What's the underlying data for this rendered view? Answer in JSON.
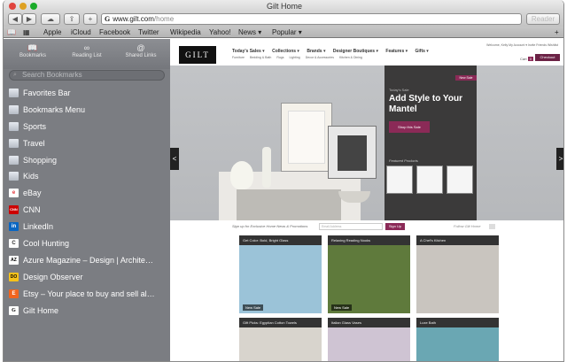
{
  "window": {
    "title": "Gilt Home"
  },
  "toolbar": {
    "back": "◀",
    "forward": "▶",
    "new_tab": "+",
    "url_host": "www.gilt.com",
    "url_path": "/home",
    "url_logo": "G",
    "reader": "Reader"
  },
  "bookmarks_bar": {
    "items": [
      "Apple",
      "iCloud",
      "Facebook",
      "Twitter",
      "Wikipedia",
      "Yahoo!",
      "News ▾",
      "Popular ▾"
    ]
  },
  "sidebar": {
    "tabs": [
      {
        "label": "Bookmarks",
        "icon": "book-icon"
      },
      {
        "label": "Reading List",
        "icon": "glasses-icon"
      },
      {
        "label": "Shared Links",
        "icon": "at-icon"
      }
    ],
    "search_placeholder": "Search Bookmarks",
    "items": [
      {
        "label": "Favorites Bar",
        "icon": "folder-icon"
      },
      {
        "label": "Bookmarks Menu",
        "icon": "folder-icon"
      },
      {
        "label": "Sports",
        "icon": "folder-icon"
      },
      {
        "label": "Travel",
        "icon": "folder-icon"
      },
      {
        "label": "Shopping",
        "icon": "folder-icon"
      },
      {
        "label": "Kids",
        "icon": "folder-icon"
      },
      {
        "label": "eBay",
        "icon": "ebay-favicon"
      },
      {
        "label": "CNN",
        "icon": "cnn-favicon"
      },
      {
        "label": "LinkedIn",
        "icon": "linkedin-favicon"
      },
      {
        "label": "Cool Hunting",
        "icon": "coolhunting-favicon"
      },
      {
        "label": "Azure Magazine – Design | Archite…",
        "icon": "azure-favicon"
      },
      {
        "label": "Design Observer",
        "icon": "designobserver-favicon"
      },
      {
        "label": "Etsy – Your place to buy and sell al…",
        "icon": "etsy-favicon"
      },
      {
        "label": "Gilt Home",
        "icon": "gilt-favicon"
      }
    ],
    "favicon_text": {
      "eBay": "e",
      "CNN": "CNN",
      "LinkedIn": "in",
      "Cool Hunting": "C",
      "Azure Magazine – Design | Archite…": "AZ",
      "Design Observer": "DO",
      "Etsy – Your place to buy and sell al…": "E",
      "Gilt Home": "G"
    }
  },
  "gilt": {
    "logo": "GILT",
    "nav": [
      "Today's Sales ▾",
      "Collections ▾",
      "Brands ▾",
      "Designer Boutiques ▾",
      "Features ▾",
      "Gifts ▾"
    ],
    "subnav": [
      "Furniture",
      "Bedding & Bath",
      "Rugs",
      "Lighting",
      "Decor & Accessories",
      "Kitchen & Dining"
    ],
    "account_links": "Welcome, Kelly   My Account ▾   Invite Friends   Wishlist",
    "cart": "Cart",
    "cart_count": "0",
    "checkout": "Checkout",
    "hero": {
      "label": "Today's Sale",
      "headline": "Add Style to Your Mantel",
      "cta": "Shop this Sale",
      "featured": "Featured Products",
      "tag": "New Sale"
    },
    "signup": {
      "text": "Sign up for Exclusive Home News & Promotions",
      "placeholder": "Email Address",
      "button": "Sign Up",
      "follow": "Follow Gilt Home"
    },
    "view_all": "View All Past Sales",
    "tiles": [
      {
        "caption": "Get Color: Bold, Bright Glass",
        "tag": "New Sale",
        "color": "#9bc3d8"
      },
      {
        "caption": "Relaxing Reading Nooks",
        "tag": "New Sale",
        "color": "#5f7a3c"
      },
      {
        "caption": "A Chef's Kitchen",
        "tag": "",
        "color": "#c9c5bf"
      },
      {
        "caption": "Gift Picks: Egyptian Cotton Towels",
        "tag": "",
        "color": "#d8d4cd"
      },
      {
        "caption": "Italian Glass Vases",
        "tag": "",
        "color": "#cfc4d3"
      },
      {
        "caption": "Luxe Bath",
        "tag": "",
        "color": "#6aa7b3"
      }
    ]
  },
  "colors": {
    "accent": "#8b2a57",
    "sidebar": "#7b7d82"
  }
}
